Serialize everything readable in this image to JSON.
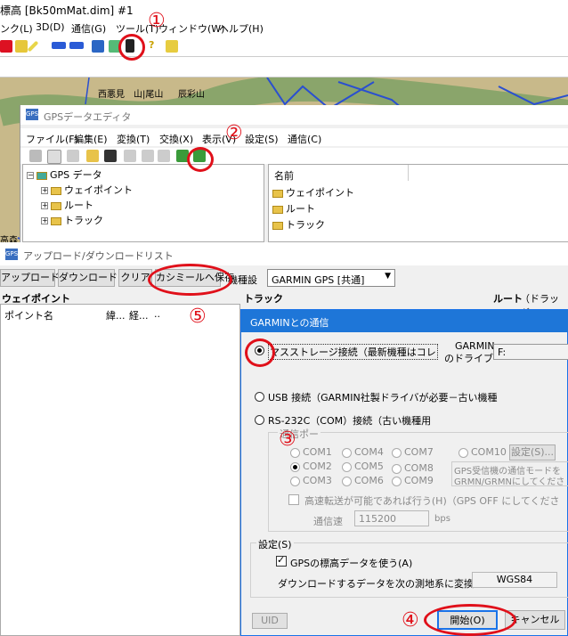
{
  "main_window": {
    "title": "標高 [Bk50mMat.dim] #1",
    "menu": [
      "ンク(L)",
      "3D(D)",
      "通信(G)",
      "ツール(T)",
      "ウィンドウ(W)",
      "ヘルプ(H)"
    ]
  },
  "map": {
    "labels": [
      "西悪見",
      "山|尾山",
      "辰彩山",
      "高森"
    ]
  },
  "gps_editor": {
    "title": "GPSデータエディタ",
    "menu": [
      "ファイル(F)",
      "編集(E)",
      "変換(T)",
      "交換(X)",
      "表示(V)",
      "設定(S)",
      "通信(C)"
    ],
    "tree": {
      "root": "GPS データ",
      "children": [
        "ウェイポイント",
        "ルート",
        "トラック"
      ]
    },
    "list": {
      "header": "名前",
      "items": [
        "ウェイポイント",
        "ルート",
        "トラック"
      ]
    }
  },
  "updown": {
    "title": "アップロード/ダウンロードリスト",
    "buttons": [
      "アップロード",
      "ダウンロード",
      "クリア",
      "カシミールへ保存"
    ],
    "device_label": "機種設",
    "device_value": "GARMIN GPS [共通]",
    "sections": {
      "waypoint": "ウェイポイント",
      "track": "トラック",
      "route": "ルート",
      "route_hint": "（ドラッグ &"
    },
    "columns": [
      "ポイント名",
      "緯...",
      "経...",
      ".."
    ]
  },
  "garmin_dialog": {
    "title": "GARMINとの通信",
    "opt_mass": "マスストレージ接続（最新機種はコレ",
    "drive_label_1": "GARMIN",
    "drive_label_2": "のドライブ",
    "drive_value": "F:",
    "opt_usb": "USB 接続（GARMIN社製ドライバが必要－古い機種",
    "opt_rs232": "RS-232C（COM）接続（古い機種用",
    "port_group": "通信ポー",
    "ports": [
      "COM1",
      "COM4",
      "COM7",
      "COM10",
      "COM2",
      "COM5",
      "COM8",
      "COM3",
      "COM6",
      "COM9"
    ],
    "port_settings": "設定(S)...",
    "port_note_1": "GPS受信機の通信モードを",
    "port_note_2": "GRMN/GRMNにしてくださ",
    "fast": "高速転送が可能であれば行う(H)（GPS OFF にしてくださ",
    "baud_label": "通信速",
    "baud_value": "115200",
    "baud_unit": "bps",
    "settings_group": "設定(S)",
    "use_elev": "GPSの標高データを使う(A)",
    "convert_label": "ダウンロードするデータを次の測地系に変換.",
    "datum": "WGS84",
    "uid": "UID",
    "start": "開始(O)",
    "cancel": "キャンセル"
  },
  "annotations": [
    "①",
    "②",
    "③",
    "④",
    "⑤"
  ]
}
